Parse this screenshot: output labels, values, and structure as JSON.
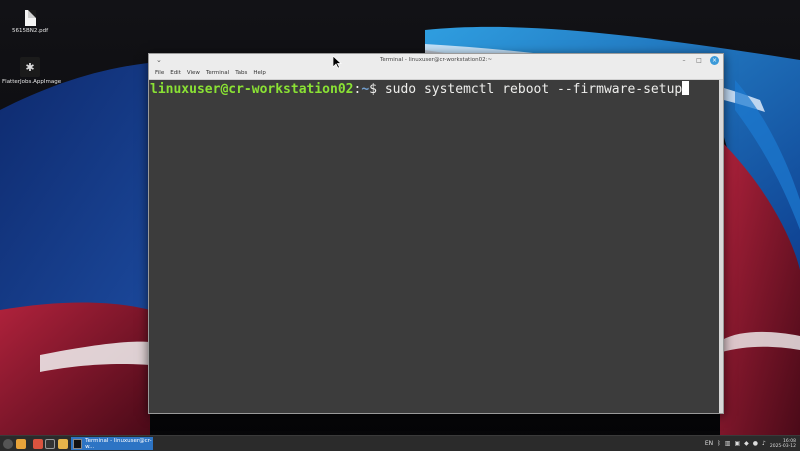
{
  "desktop": {
    "icons": [
      {
        "label": "5615BN2.pdf",
        "icon": "pdf-file-icon"
      },
      {
        "label": "FlatterJobs.AppImage",
        "icon": "appimage-icon"
      }
    ]
  },
  "window": {
    "title": "Terminal - linuxuser@cr-workstation02:~",
    "menu": [
      "File",
      "Edit",
      "View",
      "Terminal",
      "Tabs",
      "Help"
    ],
    "prompt_user": "linuxuser@cr-workstation02",
    "prompt_sep": ":",
    "prompt_path": "~",
    "prompt_symbol": "$ ",
    "command": "sudo systemctl reboot --firmware-setup"
  },
  "taskbar": {
    "active_task": "Terminal - linuxuser@cr-w...",
    "clock_time": "16:08",
    "clock_date": "2025-03-12"
  },
  "colors": {
    "terminal_bg": "#3c3c3c",
    "prompt_user": "#8ae234",
    "prompt_path": "#729fcf",
    "taskbar_active": "#2d74c4"
  }
}
